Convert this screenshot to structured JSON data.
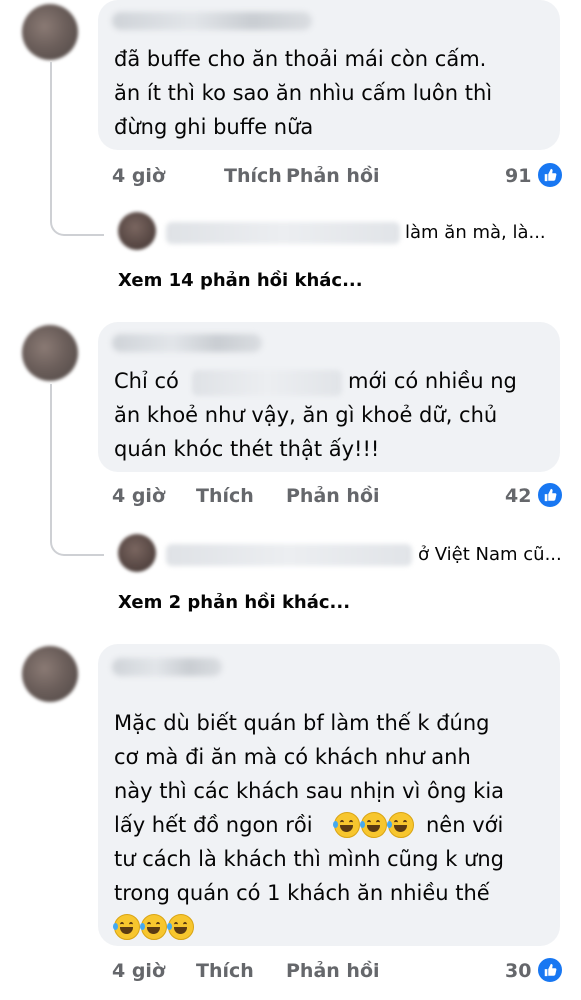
{
  "comments": [
    {
      "text_lines": [
        "đã buffe cho ăn thoải mái còn cấm.",
        "ăn ít thì ko sao ăn nhìu cấm luôn thì",
        "đừng ghi buffe nữa"
      ],
      "time": "4 giờ",
      "like_label": "Thích",
      "reply_label": "Phản hồi",
      "reaction_count": "91",
      "reply_preview": "làm ăn mà, là...",
      "more_replies": "Xem 14 phản hồi khác..."
    },
    {
      "text_lines": [
        "Chỉ có",
        "mới có nhiều ng",
        "ăn khoẻ như vậy, ăn gì khoẻ dữ, chủ",
        "quán khóc thét thật ấy!!!"
      ],
      "time": "4 giờ",
      "like_label": "Thích",
      "reply_label": "Phản hồi",
      "reaction_count": "42",
      "reply_preview": "ở Việt Nam cũ...",
      "more_replies": "Xem 2 phản hồi khác..."
    },
    {
      "text_lines": [
        "Mặc dù biết quán bf làm thế k đúng",
        "cơ mà đi ăn mà có khách như anh",
        "này thì các khách sau nhịn vì ông kia",
        "lấy hết đồ ngon rồi",
        "nên với",
        "tư cách là khách thì mình cũng k ưng",
        "trong quán có 1 khách ăn nhiều thế"
      ],
      "time": "4 giờ",
      "like_label": "Thích",
      "reply_label": "Phản hồi",
      "reaction_count": "30"
    }
  ],
  "icons": {
    "reaction": "like-thumb-icon",
    "emoji": "laughing-tears-emoji-icon"
  },
  "colors": {
    "bubble": "#f0f2f5",
    "meta_text": "#65676b",
    "like_blue": "#1877f2"
  }
}
